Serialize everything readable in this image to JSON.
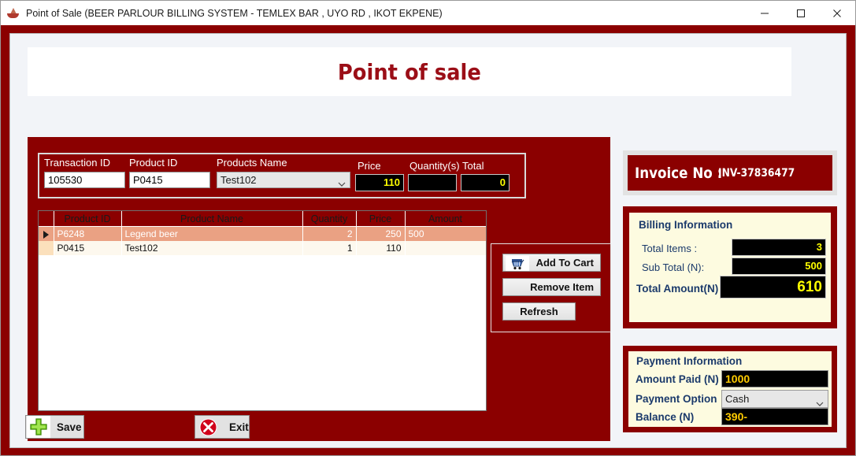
{
  "window": {
    "title": "Point of Sale (BEER PARLOUR BILLING SYSTEM - TEMLEX BAR , UYO RD , IKOT EKPENE)",
    "app_icon": "ship-icon",
    "controls": {
      "minimize": "minimize-icon",
      "maximize": "maximize-icon",
      "close": "close-icon"
    }
  },
  "header": {
    "title": "Point of sale"
  },
  "entry": {
    "transaction_id": {
      "label": "Transaction ID",
      "value": "105530"
    },
    "product_id": {
      "label": "Product ID",
      "value": "P0415"
    },
    "products_name": {
      "label": "Products Name",
      "value": "Test102",
      "options": [
        "Test102"
      ]
    },
    "price": {
      "label": "Price",
      "value": "110"
    },
    "quantity": {
      "label": "Quantity(s)",
      "value": ""
    },
    "total": {
      "label": "Total",
      "value": "0"
    }
  },
  "grid": {
    "columns": [
      "Product ID",
      "Product Name",
      "Quantity",
      "Price",
      "Amount"
    ],
    "rows": [
      {
        "selected": true,
        "product_id": "P6248",
        "product_name": "Legend beer",
        "quantity": "2",
        "price": "250",
        "amount": "500"
      },
      {
        "selected": false,
        "product_id": "P0415",
        "product_name": "Test102",
        "quantity": "1",
        "price": "110",
        "amount": ""
      }
    ]
  },
  "actions": {
    "add_to_cart": {
      "label": "Add  To  Cart",
      "icon": "shopping-cart-icon"
    },
    "remove_item": {
      "label": "Remove  Item"
    },
    "refresh": {
      "label": "Refresh"
    }
  },
  "invoice": {
    "label": "Invoice No :",
    "number": "INV-37836477"
  },
  "billing": {
    "title": "Billing Information",
    "total_items": {
      "label": "Total Items :",
      "value": "3"
    },
    "sub_total": {
      "label": "Sub Total (N):",
      "value": "500"
    },
    "total_amount": {
      "label": "Total Amount(N) :",
      "value": "610"
    }
  },
  "payment": {
    "title": "Payment Information",
    "amount_paid": {
      "label": "Amount Paid (N)",
      "value": "1000"
    },
    "payment_option": {
      "label": "Payment Option",
      "value": "Cash",
      "options": [
        "Cash"
      ]
    },
    "balance": {
      "label": "Balance (N)",
      "value": "390-"
    }
  },
  "footer": {
    "save": {
      "label": "Save",
      "icon": "green-plus-icon"
    },
    "exit": {
      "label": "Exit",
      "icon": "red-x-circle-icon"
    }
  },
  "colors": {
    "brand_red": "#8B0000",
    "title_red": "#9b0e17",
    "panel_cream": "#fdfbe0",
    "label_blue": "#1b3a6b",
    "field_yellow": "#ffff00",
    "row_selected": "#eaa183"
  }
}
